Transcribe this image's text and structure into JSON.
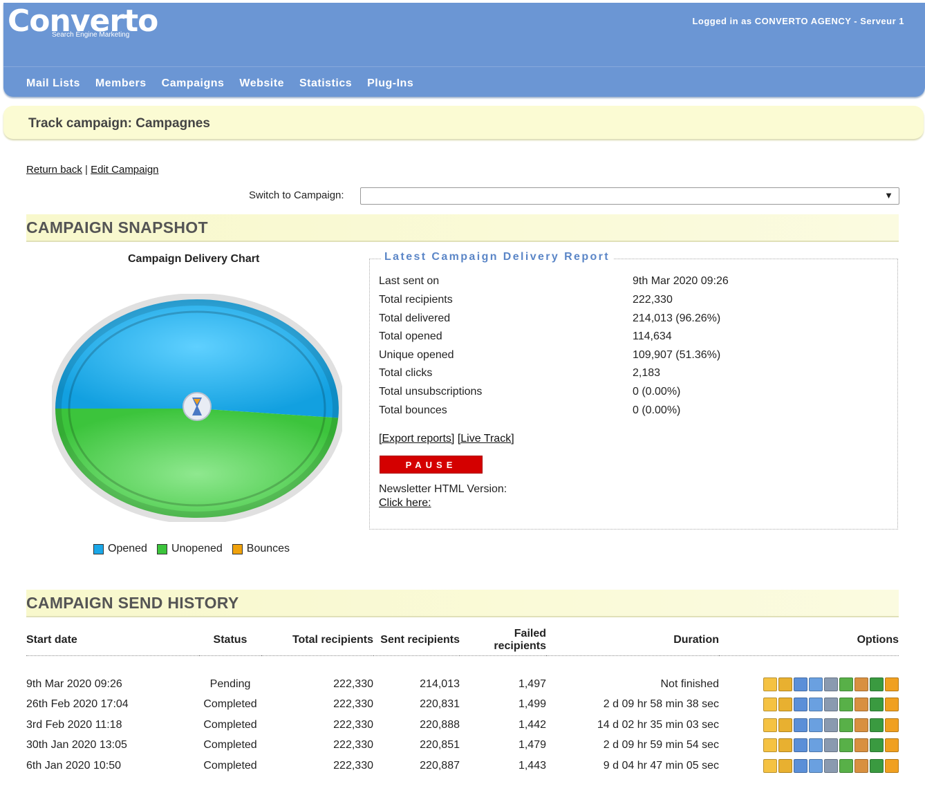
{
  "header": {
    "logo": "Converto",
    "logo_sub": "Search Engine Marketing",
    "logged_in": "Logged in as CONVERTO AGENCY - Serveur 1"
  },
  "nav": [
    "Mail Lists",
    "Members",
    "Campaigns",
    "Website",
    "Statistics",
    "Plug-Ins"
  ],
  "page_title": "Track campaign: Campagnes",
  "links": {
    "return_back": "Return back",
    "separator": "|",
    "edit_campaign": "Edit Campaign"
  },
  "switch": {
    "label": "Switch to Campaign:",
    "value": ""
  },
  "snapshot": {
    "heading": "CAMPAIGN SNAPSHOT",
    "chart_title": "Campaign Delivery Chart",
    "legend": [
      {
        "label": "Opened",
        "color": "#1aa7e8"
      },
      {
        "label": "Unopened",
        "color": "#3cc43c"
      },
      {
        "label": "Bounces",
        "color": "#f0a20c"
      }
    ]
  },
  "chart_data": {
    "type": "pie",
    "title": "Campaign Delivery Chart",
    "categories": [
      "Opened",
      "Unopened",
      "Bounces"
    ],
    "values": [
      51.36,
      48.64,
      0
    ],
    "colors": [
      "#1aa7e8",
      "#3cc43c",
      "#f0a20c"
    ]
  },
  "report": {
    "legend": "Latest Campaign Delivery Report",
    "rows": [
      {
        "label": "Last sent on",
        "value": "9th Mar 2020 09:26"
      },
      {
        "label": "Total recipients",
        "value": "222,330"
      },
      {
        "label": "Total delivered",
        "value": "214,013 (96.26%)"
      },
      {
        "label": "Total opened",
        "value": "114,634"
      },
      {
        "label": "Unique opened",
        "value": "109,907 (51.36%)"
      },
      {
        "label": "Total clicks",
        "value": "2,183"
      },
      {
        "label": "Total unsubscriptions",
        "value": "0 (0.00%)"
      },
      {
        "label": "Total bounces",
        "value": "0 (0.00%)"
      }
    ],
    "export_reports": "[Export reports]",
    "live_track": "[Live Track]",
    "pause": "PAUSE",
    "newsletter_label": "Newsletter HTML Version:",
    "click_here": "Click here:"
  },
  "history": {
    "heading": "CAMPAIGN SEND HISTORY",
    "columns": [
      "Start date",
      "Status",
      "Total recipients",
      "Sent recipients",
      "Failed recipients",
      "Duration",
      "Options"
    ],
    "rows": [
      {
        "start": "9th Mar 2020 09:26",
        "status": "Pending",
        "total": "222,330",
        "sent": "214,013",
        "failed": "1,497",
        "duration": "Not finished"
      },
      {
        "start": "26th Feb 2020 17:04",
        "status": "Completed",
        "total": "222,330",
        "sent": "220,831",
        "failed": "1,499",
        "duration": "2 d 09 hr 58 min 38 sec"
      },
      {
        "start": "3rd Feb 2020 11:18",
        "status": "Completed",
        "total": "222,330",
        "sent": "220,888",
        "failed": "1,442",
        "duration": "14 d 02 hr 35 min 03 sec"
      },
      {
        "start": "30th Jan 2020 13:05",
        "status": "Completed",
        "total": "222,330",
        "sent": "220,851",
        "failed": "1,479",
        "duration": "2 d 09 hr 59 min 54 sec"
      },
      {
        "start": "6th Jan 2020 10:50",
        "status": "Completed",
        "total": "222,330",
        "sent": "220,887",
        "failed": "1,443",
        "duration": "9 d 04 hr 47 min 05 sec"
      }
    ],
    "option_icons": [
      "edit-icon",
      "report-icon",
      "list-icon",
      "open-mail-icon",
      "print-mail-icon",
      "forward-mail-icon",
      "user-icon",
      "export-icon",
      "warning-mail-icon"
    ]
  }
}
